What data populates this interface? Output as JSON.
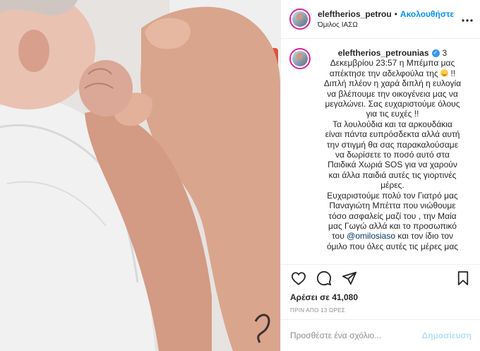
{
  "header": {
    "username": "eleftherios_petrou",
    "separator": "•",
    "follow_label": "Ακολουθήστε",
    "location": "Όμιλος ΙΑΣΩ"
  },
  "caption": {
    "username": "eleftherios_petrounias",
    "lines": [
      "Δεκεμβρίου 23:57 η Μπέμπα μας",
      "Διπλή πλέον η χαρά διπλή η ευλογία",
      "να βλέπουμε την οικογένεια μας να",
      "μεγαλώνει. Σας ευχαριστούμε όλους",
      "για τις ευχές !!",
      "Τα λουλούδια και τα αρκουδάκια",
      "είναι πάντα ευπρόσδεκτα αλλά αυτή",
      "την στιγμή θα σας παρακαλούσαμε",
      "να δωρίσετε το ποσό αυτό στα",
      "Παιδικά Χωριά SOS για να χαρούν",
      "και άλλα παιδιά αυτές τις γιορτινές",
      "μέρες.",
      "Ευχαριστούμε πολύ τον Γιατρό μας",
      "Παναγιώτη Μπέττα που νιώθουμε",
      "τόσο ασφαλείς μαζί του , την Μαία",
      "μας Γωγώ αλλά και το προσωπικό",
      "και τον ίδιο τον",
      "όμιλο που όλες αυτές τις μέρες μας"
    ],
    "first_line_suffix": "3",
    "line2_a": "απέκτησε την αδελφούλα της",
    "line2_b": "!!",
    "line17_prefix": "του",
    "mention": "@omilosiaso"
  },
  "likes": {
    "label": "Αρέσει σε 41,080"
  },
  "time_ago": "ΠΡΙΝ ΑΠΟ 13 ΩΡΕΣ",
  "add_comment": {
    "placeholder": "Προσθέστε ένα σχόλιο...",
    "post_label": "Δημοσίευση"
  },
  "icons": {
    "like": "heart-icon",
    "comment": "comment-icon",
    "share": "paper-plane-icon",
    "save": "bookmark-icon",
    "more": "more-options-icon"
  },
  "colors": {
    "accent": "#0095f6",
    "post_disabled": "#b2dffc",
    "muted": "#8e8e8e",
    "verified": "#3897f0"
  }
}
